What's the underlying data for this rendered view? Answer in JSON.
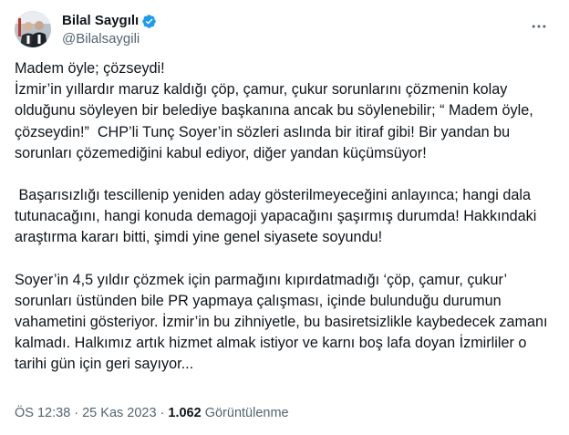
{
  "author": {
    "display_name": "Bilal Saygılı",
    "handle": "@Bilalsaygili",
    "verified": true,
    "avatar_icon": "profile-photo"
  },
  "more_icon": "more-options-icon",
  "tweet": {
    "paragraph_1": "Madem öyle; çözseydi!\nİzmir’in yıllardır maruz kaldığı çöp, çamur, çukur sorunlarını çözmenin kolay olduğunu söyleyen bir belediye başkanına ancak bu söylenebilir; “ Madem öyle, çözseydin!”  CHP’li Tunç Soyer’in sözleri aslında bir itiraf gibi! Bir yandan bu sorunları çözemediğini kabul ediyor, diğer yandan küçümsüyor!",
    "paragraph_2": " Başarısızlığı tescillenip yeniden aday gösterilmeyeceğini anlayınca; hangi dala tutunacağını, hangi konuda demagoji yapacağını şaşırmış durumda! Hakkındaki araştırma kararı bitti, şimdi yine genel siyasete soyundu!",
    "paragraph_3": "Soyer’in 4,5 yıldır çözmek için parmağını kıpırdatmadığı ‘çöp, çamur, çukur’ sorunları üstünden bile PR yapmaya çalışması, içinde bulunduğu durumun vahametini gösteriyor. İzmir’in bu zihniyetle, bu basiretsizlikle kaybedecek zamanı kalmadı. Halkımız artık hizmet almak istiyor ve karnı boş lafa doyan İzmirliler o tarihi gün için geri sayıyor..."
  },
  "meta": {
    "time": "ÖS 12:38",
    "separator": "·",
    "date": "25 Kas 2023",
    "views_count": "1.062",
    "views_label": "Görüntülenme"
  },
  "colors": {
    "verified_blue": "#1d9bf0",
    "secondary_text": "#536471",
    "primary_text": "#0f1419"
  }
}
